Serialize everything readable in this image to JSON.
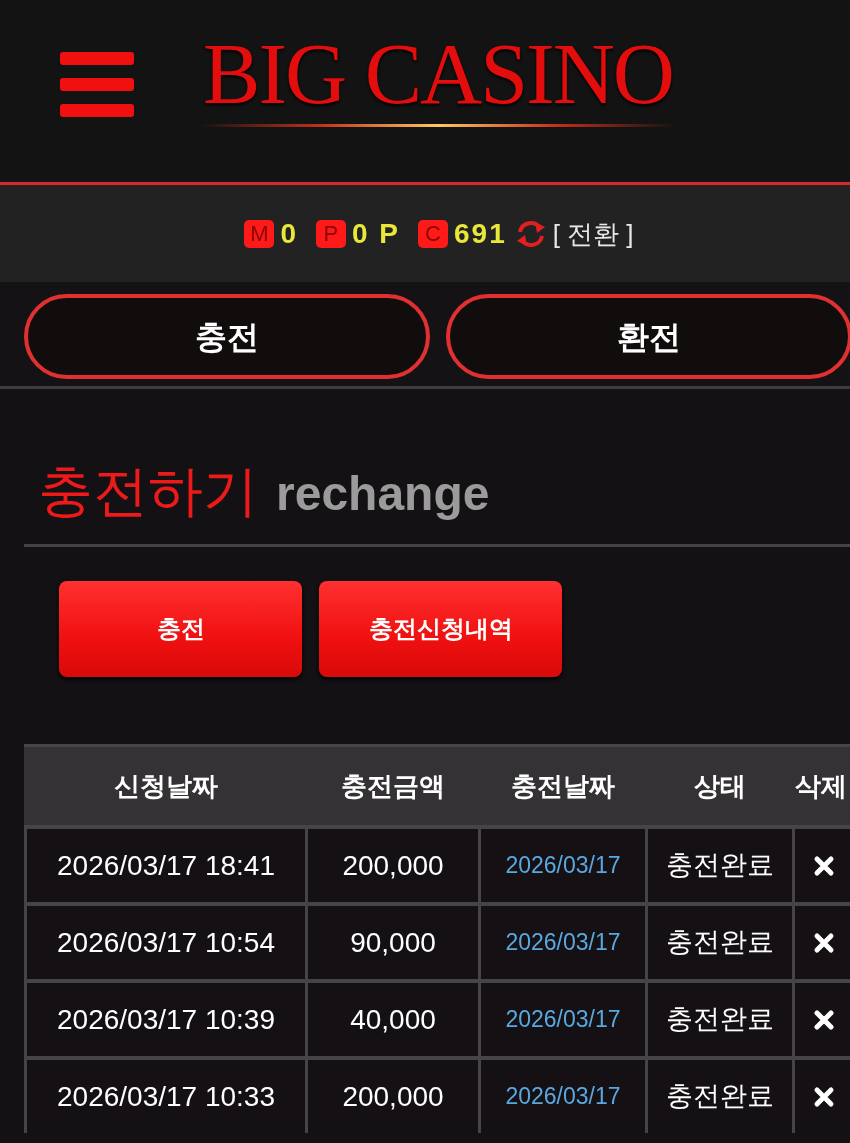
{
  "header": {
    "logo": "BIG CASINO"
  },
  "balance_bar": {
    "items": [
      {
        "badge": "M",
        "value": "0"
      },
      {
        "badge": "P",
        "value": "0 P"
      },
      {
        "badge": "C",
        "value": "691"
      }
    ],
    "convert_link": "[ 전환 ]"
  },
  "nav_buttons": [
    {
      "label": "충전"
    },
    {
      "label": "환전"
    }
  ],
  "section": {
    "title": "충전하기",
    "subtitle": "rechange"
  },
  "action_buttons": [
    {
      "label": "충전"
    },
    {
      "label": "충전신청내역"
    }
  ],
  "table": {
    "columns": [
      "신청날짜",
      "충전금액",
      "충전날짜",
      "상태",
      "삭제"
    ],
    "rows": [
      {
        "requested": "2026/03/17 18:41",
        "amount": "200,000",
        "charged_date": "2026/03/17",
        "status": "충전완료"
      },
      {
        "requested": "2026/03/17 10:54",
        "amount": "90,000",
        "charged_date": "2026/03/17",
        "status": "충전완료"
      },
      {
        "requested": "2026/03/17 10:39",
        "amount": "40,000",
        "charged_date": "2026/03/17",
        "status": "충전완료"
      },
      {
        "requested": "2026/03/17 10:33",
        "amount": "200,000",
        "charged_date": "2026/03/17",
        "status": "충전완료"
      }
    ]
  }
}
